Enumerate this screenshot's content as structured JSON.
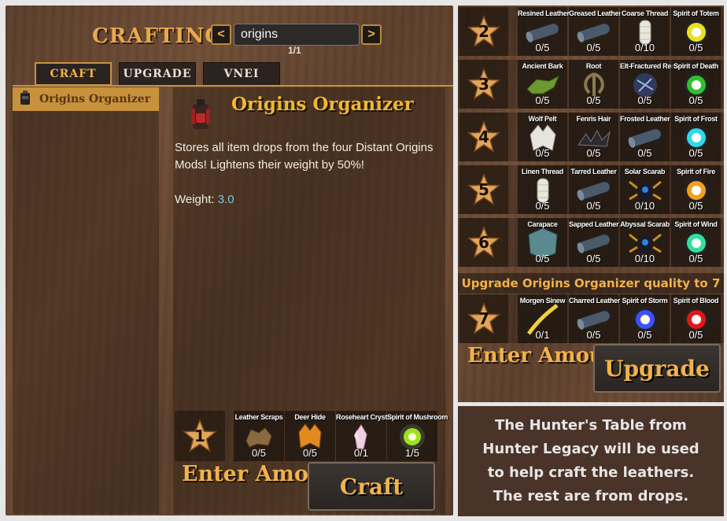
{
  "crafting": {
    "title": "CRAFTING",
    "search_value": "origins",
    "page_indicator": "1/1",
    "prev_arrow": "<",
    "next_arrow": ">",
    "tabs": [
      {
        "label": "CRAFT"
      },
      {
        "label": "UPGRADE"
      },
      {
        "label": "VNEI"
      }
    ],
    "list": [
      {
        "label": "Origins Organizer",
        "icon": "backpack-icon"
      }
    ],
    "item": {
      "title": "Origins Organizer",
      "description": "Stores all item drops from the four Distant Origins Mods! Lightens their weight by 50%!",
      "weight_label": "Weight:",
      "weight_value": "3.0"
    },
    "quality": "1",
    "requirements": [
      {
        "name": "Leather Scraps",
        "count": "0/5",
        "icon": "leather-scraps-icon"
      },
      {
        "name": "Deer Hide",
        "count": "0/5",
        "icon": "deer-hide-icon"
      },
      {
        "name": "Roseheart Crystal",
        "count": "0/1",
        "icon": "crystal-icon"
      },
      {
        "name": "Spirit of Mushroom",
        "count": "1/5",
        "icon": "spirit-orb-icon"
      }
    ],
    "amount_placeholder": "Enter Amount...",
    "craft_button": "Craft"
  },
  "upgrade": {
    "banner": "Upgrade Origins Organizer quality to 7",
    "amount_placeholder": "Enter Amount...",
    "upgrade_button": "Upgrade",
    "rows": [
      {
        "level": "2",
        "items": [
          {
            "name": "Resined Leather",
            "count": "0/5",
            "icon": "leather-roll-icon"
          },
          {
            "name": "Greased Leather",
            "count": "0/5",
            "icon": "leather-roll-icon"
          },
          {
            "name": "Coarse Thread",
            "count": "0/10",
            "icon": "thread-icon"
          },
          {
            "name": "Spirit of Totem",
            "count": "0/5",
            "icon": "spirit-orb-icon"
          }
        ]
      },
      {
        "level": "3",
        "items": [
          {
            "name": "Ancient Bark",
            "count": "0/5",
            "icon": "bark-icon"
          },
          {
            "name": "Root",
            "count": "0/5",
            "icon": "root-icon"
          },
          {
            "name": "Elt-Fractured Remains",
            "count": "0/5",
            "icon": "remains-icon"
          },
          {
            "name": "Spirit of Death",
            "count": "0/5",
            "icon": "spirit-orb-icon"
          }
        ]
      },
      {
        "level": "4",
        "items": [
          {
            "name": "Wolf Pelt",
            "count": "0/5",
            "icon": "pelt-icon"
          },
          {
            "name": "Fenris Hair",
            "count": "0/5",
            "icon": "hair-icon"
          },
          {
            "name": "Frosted Leather",
            "count": "0/5",
            "icon": "leather-roll-icon"
          },
          {
            "name": "Spirit of Frost",
            "count": "0/5",
            "icon": "spirit-orb-icon"
          }
        ]
      },
      {
        "level": "5",
        "items": [
          {
            "name": "Linen Thread",
            "count": "0/5",
            "icon": "thread-icon"
          },
          {
            "name": "Tarred Leather",
            "count": "0/5",
            "icon": "leather-roll-icon"
          },
          {
            "name": "Solar Scarab",
            "count": "0/10",
            "icon": "scarab-icon"
          },
          {
            "name": "Spirit of Fire",
            "count": "0/5",
            "icon": "spirit-orb-icon"
          }
        ]
      },
      {
        "level": "6",
        "items": [
          {
            "name": "Carapace",
            "count": "0/5",
            "icon": "carapace-icon"
          },
          {
            "name": "Sapped Leather",
            "count": "0/5",
            "icon": "leather-roll-icon"
          },
          {
            "name": "Abyssal Scarab",
            "count": "0/10",
            "icon": "scarab-icon"
          },
          {
            "name": "Spirit of Wind",
            "count": "0/5",
            "icon": "spirit-orb-icon"
          }
        ]
      },
      {
        "level": "7",
        "items": [
          {
            "name": "Morgen Sinew",
            "count": "0/1",
            "icon": "sinew-icon"
          },
          {
            "name": "Charred Leather",
            "count": "0/5",
            "icon": "leather-roll-icon"
          },
          {
            "name": "Spirit of Storm",
            "count": "0/5",
            "icon": "spirit-orb-icon"
          },
          {
            "name": "Spirit of Blood",
            "count": "0/5",
            "icon": "spirit-orb-icon"
          }
        ]
      }
    ]
  },
  "caption": {
    "line1": "The Hunter's Table from",
    "line2": "Hunter Legacy will be used",
    "line3": "to help craft the leathers.",
    "line4": "The rest are from drops."
  },
  "colors": {
    "accent": "#f0b24a",
    "item_title": "#f0b82e",
    "weight_value": "#7bc7e6",
    "selected_row": "#c8923c",
    "orb_totem": "#e8e020",
    "orb_death": "#30c030",
    "orb_frost": "#30d8e8",
    "orb_fire": "#f0a020",
    "orb_wind": "#30e0a0",
    "orb_storm": "#4050ff",
    "orb_blood": "#e01818",
    "orb_mushroom": "#a0e020"
  }
}
